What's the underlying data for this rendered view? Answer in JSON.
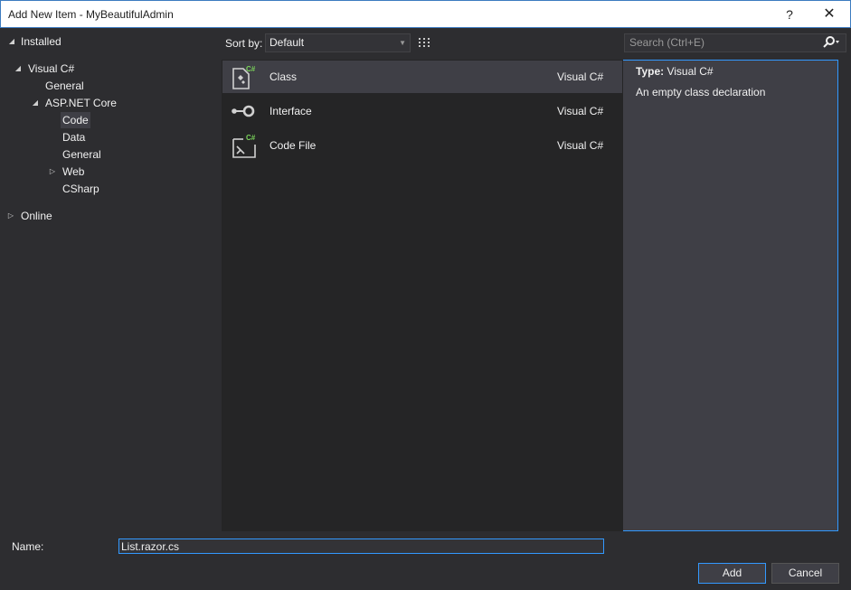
{
  "window": {
    "title": "Add New Item - MyBeautifulAdmin",
    "help_glyph": "?",
    "close_glyph": "✕"
  },
  "tree": {
    "installed": "Installed",
    "visual_csharp": "Visual C#",
    "general": "General",
    "aspnet_core": "ASP.NET Core",
    "code": "Code",
    "data": "Data",
    "general_sub": "General",
    "web": "Web",
    "csharp": "CSharp",
    "online": "Online"
  },
  "toolbar": {
    "sort_label": "Sort by:",
    "sort_value": "Default",
    "search_placeholder": "Search (Ctrl+E)"
  },
  "templates": [
    {
      "name": "Class",
      "language": "Visual C#",
      "icon": "class-icon",
      "selected": true
    },
    {
      "name": "Interface",
      "language": "Visual C#",
      "icon": "interface-icon",
      "selected": false
    },
    {
      "name": "Code File",
      "language": "Visual C#",
      "icon": "code-file-icon",
      "selected": false
    }
  ],
  "details": {
    "type_label": "Type:",
    "type_value": "Visual C#",
    "description": "An empty class declaration"
  },
  "form": {
    "name_label": "Name:",
    "name_value": "List.razor.cs",
    "add_label": "Add",
    "cancel_label": "Cancel"
  },
  "colors": {
    "background": "#2d2d30",
    "list_background": "#252526",
    "selection": "#3f3f46",
    "accent": "#3399ff",
    "csharp_badge": "#7ad35a"
  }
}
